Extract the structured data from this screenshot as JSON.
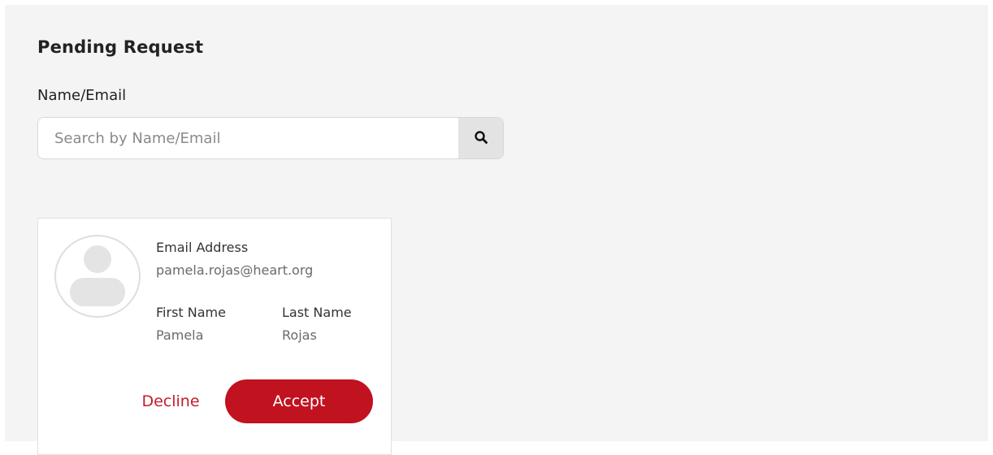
{
  "page": {
    "title": "Pending Request"
  },
  "search": {
    "label": "Name/Email",
    "placeholder": "Search by Name/Email",
    "value": "",
    "button_icon": "search-icon"
  },
  "request_card": {
    "avatar_icon": "user-placeholder-icon",
    "email_label": "Email Address",
    "email_value": "pamela.rojas@heart.org",
    "first_name_label": "First Name",
    "first_name_value": "Pamela",
    "last_name_label": "Last Name",
    "last_name_value": "Rojas",
    "decline_label": "Decline",
    "accept_label": "Accept"
  },
  "colors": {
    "accent": "#c1121f",
    "panel_background": "#f4f4f4"
  }
}
